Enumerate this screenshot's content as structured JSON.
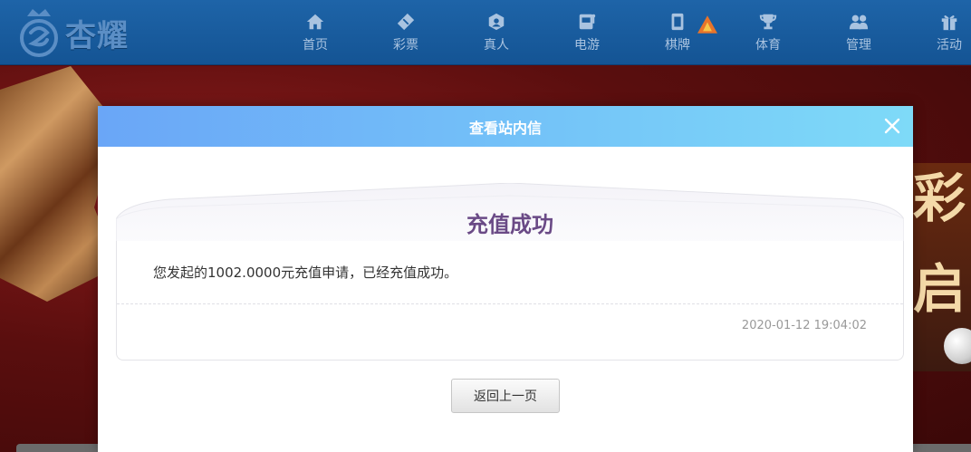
{
  "header": {
    "logo_text": "杏耀",
    "nav": [
      {
        "label": "首页",
        "icon": "home-icon"
      },
      {
        "label": "彩票",
        "icon": "lottery-ticket-icon"
      },
      {
        "label": "真人",
        "icon": "live-dealer-icon"
      },
      {
        "label": "电游",
        "icon": "slot-machine-icon"
      },
      {
        "label": "棋牌",
        "icon": "mahjong-tile-icon",
        "badge": "hot-flame-icon"
      },
      {
        "label": "体育",
        "icon": "trophy-icon"
      },
      {
        "label": "管理",
        "icon": "users-icon"
      },
      {
        "label": "活动",
        "icon": "gift-icon"
      }
    ]
  },
  "banner": {
    "right_promo_text_1": "彩",
    "right_promo_text_2": "启"
  },
  "modal": {
    "title": "查看站内信",
    "message": {
      "title": "充值成功",
      "content": "您发起的1002.0000元充值申请，已经充值成功。",
      "time": "2020-01-12 19:04:02"
    },
    "back_button_label": "返回上一页"
  },
  "colors": {
    "nav_bar": "#1e64a8",
    "modal_header_start": "#6aa6f7",
    "modal_header_end": "#7edaf8",
    "message_title": "#6a4a86"
  }
}
